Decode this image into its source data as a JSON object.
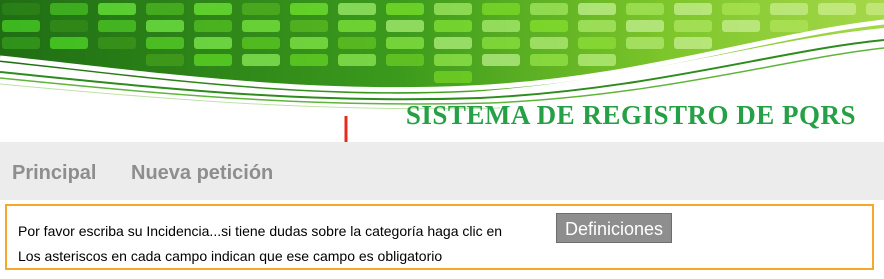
{
  "header": {
    "title": "SISTEMA DE REGISTRO DE PQRS"
  },
  "nav": {
    "home": "Principal",
    "new_request": "Nueva petición"
  },
  "notice": {
    "line1": "Por favor escriba su Incidencia...si tiene dudas sobre la categoría haga clic en",
    "button": "Definiciones",
    "line2": "Los asteriscos en cada campo indican que ese campo es obligatorio"
  },
  "colors": {
    "title_green": "#25a047",
    "nav_text": "#8e8e8e",
    "notice_border": "#f7a72c",
    "button_bg": "#8e8e8e",
    "arrow": "#e62b1c"
  }
}
